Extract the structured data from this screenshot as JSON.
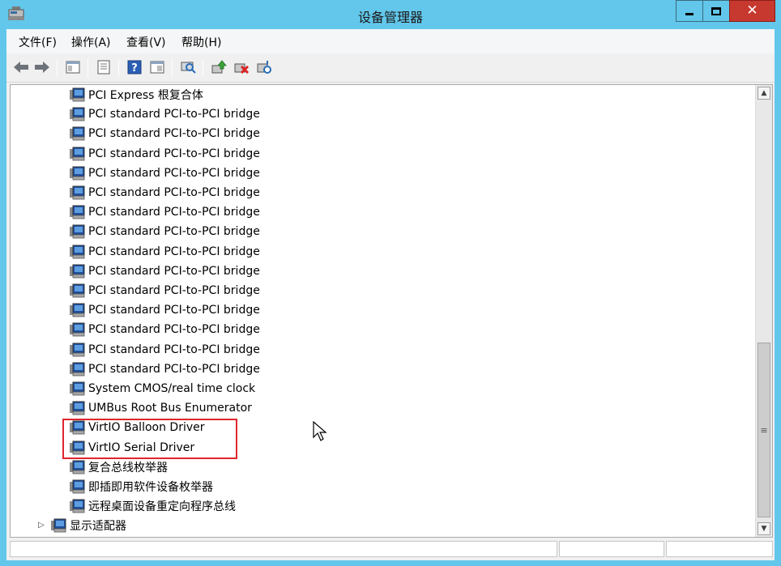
{
  "window": {
    "title": "设备管理器",
    "close_glyph": "✕"
  },
  "menu": [
    "文件(F)",
    "操作(A)",
    "查看(V)",
    "帮助(H)"
  ],
  "toolbar": [
    "back-arrow-icon",
    "forward-arrow-icon",
    "show-hide-tree-icon",
    "properties-icon",
    "help-icon",
    "view-icon",
    "scan-hardware-icon",
    "update-driver-icon",
    "uninstall-icon",
    "disable-icon"
  ],
  "tree": {
    "children": [
      "PCI Express 根复合体",
      "PCI standard PCI-to-PCI bridge",
      "PCI standard PCI-to-PCI bridge",
      "PCI standard PCI-to-PCI bridge",
      "PCI standard PCI-to-PCI bridge",
      "PCI standard PCI-to-PCI bridge",
      "PCI standard PCI-to-PCI bridge",
      "PCI standard PCI-to-PCI bridge",
      "PCI standard PCI-to-PCI bridge",
      "PCI standard PCI-to-PCI bridge",
      "PCI standard PCI-to-PCI bridge",
      "PCI standard PCI-to-PCI bridge",
      "PCI standard PCI-to-PCI bridge",
      "PCI standard PCI-to-PCI bridge",
      "PCI standard PCI-to-PCI bridge",
      "System CMOS/real time clock",
      "UMBus Root Bus Enumerator",
      "VirtIO Balloon Driver",
      "VirtIO Serial Driver",
      "复合总线枚举器",
      "即插即用软件设备枚举器",
      "远程桌面设备重定向程序总线"
    ],
    "category": "显示适配器"
  },
  "colors": {
    "titlebar": "#62c7ea",
    "close_button": "#c7382f",
    "highlight": "#e0252e"
  }
}
